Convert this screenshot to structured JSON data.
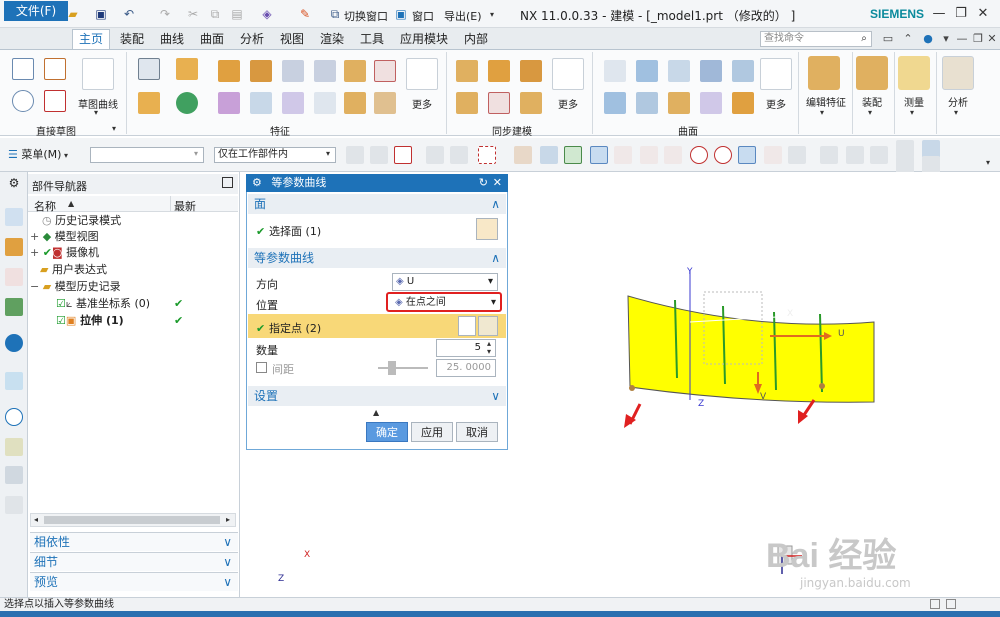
{
  "app": {
    "logo": "NX",
    "title": "NX 11.0.0.33 - 建模 - [_model1.prt （修改的） ]",
    "brand": "SIEMENS",
    "switch_window": "切换窗口",
    "window": "窗口",
    "export": "导出(E)"
  },
  "tabs": {
    "file": "文件(F)",
    "items": [
      "主页",
      "装配",
      "曲线",
      "曲面",
      "分析",
      "视图",
      "渲染",
      "工具",
      "应用模块",
      "内部"
    ],
    "active": "主页",
    "search_placeholder": "查找命令"
  },
  "ribbon": {
    "sketch_curve_label": "草图曲线",
    "more": "更多",
    "groups": [
      "直接草图",
      "特征",
      "同步建模",
      "曲面"
    ],
    "edit_feature": "编辑特征",
    "assembly": "装配",
    "measure": "测量",
    "analysis": "分析"
  },
  "toolbar2": {
    "menu": "菜单(M)",
    "filter_value": "",
    "scope_value": "仅在工作部件内"
  },
  "navigator": {
    "title": "部件导航器",
    "col_name": "名称",
    "col_latest": "最新",
    "rows": [
      {
        "label": "历史记录模式",
        "check": ""
      },
      {
        "label": "模型视图",
        "check": ""
      },
      {
        "label": "摄像机",
        "check": ""
      },
      {
        "label": "用户表达式",
        "check": ""
      },
      {
        "label": "模型历史记录",
        "check": ""
      },
      {
        "label": "基准坐标系 (0)",
        "check": "✔"
      },
      {
        "label": "拉伸 (1)",
        "check": "✔"
      }
    ],
    "sections": [
      "相依性",
      "细节",
      "预览"
    ]
  },
  "dialog": {
    "title": "等参数曲线",
    "face_section": "面",
    "select_face": "选择面 (1)",
    "curve_section": "等参数曲线",
    "direction_label": "方向",
    "direction_value": "U",
    "position_label": "位置",
    "position_value": "在点之间",
    "specify_point": "指定点 (2)",
    "count_label": "数量",
    "count_value": "5",
    "spacing_label": "间距",
    "spacing_value": "25. 0000",
    "settings_section": "设置",
    "ok": "确定",
    "apply": "应用",
    "cancel": "取消"
  },
  "viewport": {
    "axis_x": "X",
    "axis_y": "Y",
    "axis_z": "Z",
    "axis_u": "U",
    "axis_v": "V",
    "triad_x": "X",
    "triad_z": "Z"
  },
  "status": {
    "text": "选择点以插入等参数曲线"
  },
  "watermark": {
    "text": "Bai 经验",
    "sub": "jingyan.baidu.com"
  }
}
